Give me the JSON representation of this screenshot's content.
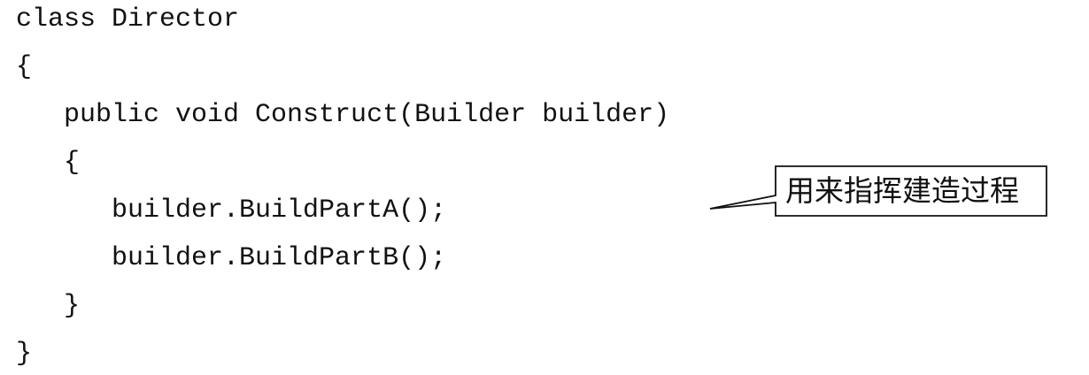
{
  "code": {
    "lines": [
      "class Director",
      "{",
      "   public void Construct(Builder builder)",
      "   {",
      "      builder.BuildPartA();",
      "      builder.BuildPartB();",
      "   }",
      "}"
    ]
  },
  "callout": {
    "text": "用来指挥建造过程"
  }
}
